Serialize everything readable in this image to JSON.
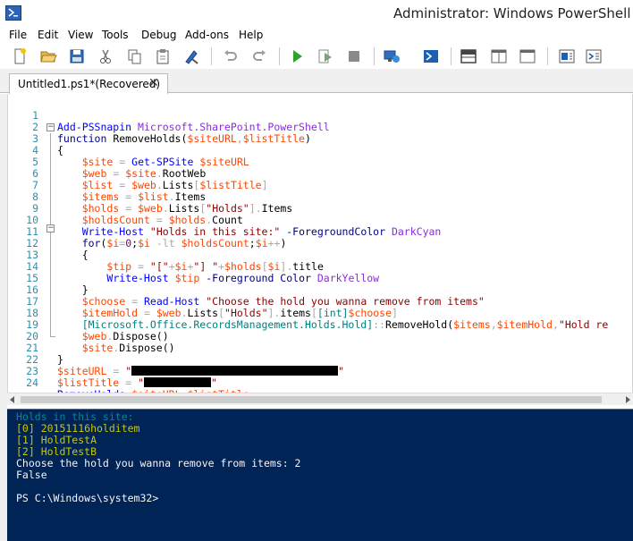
{
  "window": {
    "title": "Administrator: Windows PowerShell ISE",
    "icon": "powershell-icon"
  },
  "menu": [
    "File",
    "Edit",
    "View",
    "Tools",
    "Debug",
    "Add-ons",
    "Help"
  ],
  "toolbar": {
    "icons": [
      "new-file-icon",
      "open-folder-icon",
      "save-icon",
      "cut-icon",
      "copy-icon",
      "paste-icon",
      "clear-console-icon",
      "undo-icon",
      "redo-icon",
      "run-icon",
      "run-selection-icon",
      "stop-icon",
      "new-remote-tab-icon",
      "powershell-console-icon",
      "show-script-top-icon",
      "show-script-right-icon",
      "show-script-maximized-icon",
      "show-command-icon",
      "show-addon-icon"
    ]
  },
  "tab": {
    "label": "Untitled1.ps1*(Recovered)",
    "close": "✕"
  },
  "editor": {
    "lines": [
      {
        "n": "1",
        "text": "Add-PSSnapin Microsoft.SharePoint.PowerShell"
      },
      {
        "n": "2",
        "text": "function RemoveHolds($siteURL,$listTitle)"
      },
      {
        "n": "3",
        "text": "{"
      },
      {
        "n": "4",
        "text": "    $site = Get-SPSite $siteURL"
      },
      {
        "n": "5",
        "text": "    $web = $site.RootWeb"
      },
      {
        "n": "6",
        "text": "    $list = $web.Lists[$listTitle]"
      },
      {
        "n": "7",
        "text": "    $items = $list.Items"
      },
      {
        "n": "8",
        "text": "    $holds = $web.Lists[\"Holds\"].Items"
      },
      {
        "n": "9",
        "text": "    $holdsCount = $holds.Count"
      },
      {
        "n": "10",
        "text": "    Write-Host \"Holds in this site:\" -ForegroundColor DarkCyan"
      },
      {
        "n": "11",
        "text": "    for($i=0;$i -lt $holdsCount;$i++)"
      },
      {
        "n": "12",
        "text": "    {"
      },
      {
        "n": "13",
        "text": "        $tip = \"[\"+$i+\"] \"+$holds[$i].title"
      },
      {
        "n": "14",
        "text": "        Write-Host $tip -Foreground Color DarkYellow"
      },
      {
        "n": "15",
        "text": "    }"
      },
      {
        "n": "16",
        "text": "    $choose = Read-Host \"Choose the hold you wanna remove from items\""
      },
      {
        "n": "17",
        "text": "    $itemHold = $web.Lists[\"Holds\"].items[[int]$choose]"
      },
      {
        "n": "18",
        "text": "    [Microsoft.Office.RecordsManagement.Holds.Hold]::RemoveHold($items,$itemHold,\"Hold re"
      },
      {
        "n": "19",
        "text": "    $web.Dispose()"
      },
      {
        "n": "20",
        "text": "    $site.Dispose()"
      },
      {
        "n": "21",
        "text": "}"
      },
      {
        "n": "22",
        "text": "$siteURL = \"[redacted]\""
      },
      {
        "n": "23",
        "text": "$listTitle = \"[redacted]\""
      },
      {
        "n": "24",
        "text": "RemoveHolds $siteURL $listTitle"
      }
    ]
  },
  "console": {
    "lines": [
      {
        "text": "Holds in this site:",
        "color": "#008b8b"
      },
      {
        "text": "[0] 20151116holditem",
        "color": "#c8c800"
      },
      {
        "text": "[1] HoldTestA",
        "color": "#c8c800"
      },
      {
        "text": "[2] HoldTestB",
        "color": "#c8c800"
      },
      {
        "text": "Choose the hold you wanna remove from items: 2",
        "color": "#f5f5f5"
      },
      {
        "text": "False",
        "color": "#f5f5f5"
      },
      {
        "text": "",
        "color": "#f5f5f5"
      },
      {
        "text": "PS C:\\Windows\\system32>",
        "color": "#f5f5f5"
      }
    ]
  },
  "colors": {
    "console_bg": "#012456",
    "line_number": "#2b91af",
    "command": "#0000ff",
    "variable": "#ff4500",
    "string": "#8b0000"
  }
}
